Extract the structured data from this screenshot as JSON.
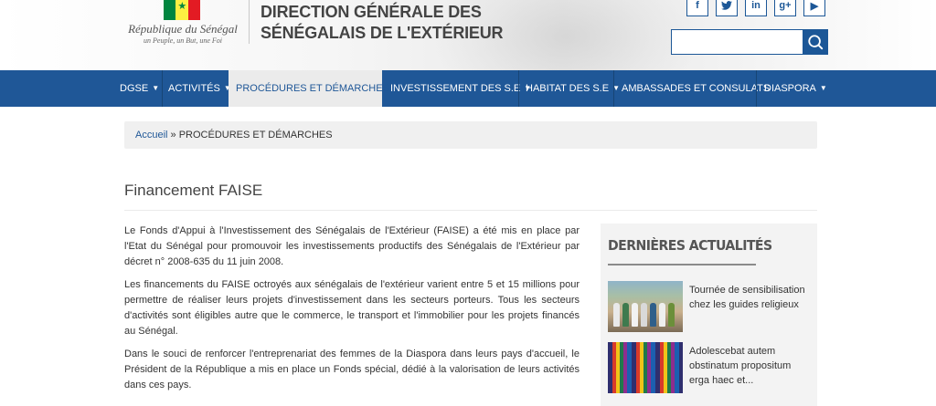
{
  "header": {
    "brand_name": "République du Sénégal",
    "brand_motto": "un Peuple, un But, une Foi",
    "title_line1": "DIRECTION GÉNÉRALE DES",
    "title_line2": "SÉNÉGALAIS DE L'EXTÉRIEUR",
    "socials": [
      {
        "icon": "facebook-icon",
        "glyph": "f"
      },
      {
        "icon": "twitter-icon",
        "glyph": "t"
      },
      {
        "icon": "linkedin-icon",
        "glyph": "in"
      },
      {
        "icon": "google-plus-icon",
        "glyph": "g+"
      },
      {
        "icon": "youtube-icon",
        "glyph": "▶"
      }
    ],
    "search": {
      "placeholder": "",
      "value": ""
    }
  },
  "nav": {
    "items": [
      {
        "label": "DGSE",
        "caret": "▼"
      },
      {
        "label": "ACTIVITÉS",
        "caret": "▼"
      },
      {
        "label": "PROCÉDURES ET DÉMARCHES",
        "caret": ""
      },
      {
        "label": "INVESTISSEMENT DES S.E",
        "caret": "▼"
      },
      {
        "label": "HABITAT DES S.E",
        "caret": "▼"
      },
      {
        "label": "AMBASSADES ET CONSULATS",
        "caret": ""
      },
      {
        "label": "DIASPORA",
        "caret": "▼"
      }
    ]
  },
  "breadcrumb": {
    "home": "Accueil",
    "separator": " » ",
    "current": "PROCÉDURES ET DÉMARCHES"
  },
  "page": {
    "title": "Financement FAISE",
    "paragraphs": [
      "Le Fonds d'Appui à l'Investissement des Sénégalais de l'Extérieur (FAISE) a été mis en place par l'Etat du Sénégal pour promouvoir les investissements productifs des Sénégalais de l'Extérieur par décret n° 2008-635 du 11 juin 2008.",
      "Les financements du FAISE octroyés aux sénégalais de l'extérieur varient entre 5 et 15 millions pour permettre de réaliser leurs projets d'investissement dans les secteurs porteurs. Tous les secteurs d'activités sont éligibles autre que le commerce, le transport et l'immobilier pour les projets financés au Sénégal.",
      "Dans le souci de renforcer l'entreprenariat des femmes de la Diaspora dans leurs pays d'accueil, le Président de la République a mis en place un Fonds spécial, dédié à la valorisation de leurs activités dans ces pays."
    ]
  },
  "sidebar": {
    "title": "DERNIÈRES ACTUALITÉS",
    "news": [
      {
        "title": "Tournée de sensibilisation chez les guides religieux"
      },
      {
        "title": "Adolescebat autem obstinatum propositum erga haec et..."
      }
    ]
  },
  "colors": {
    "nav_bg": "#1f5797",
    "nav_active_bg": "#ebebeb",
    "accent": "#1c5797"
  }
}
